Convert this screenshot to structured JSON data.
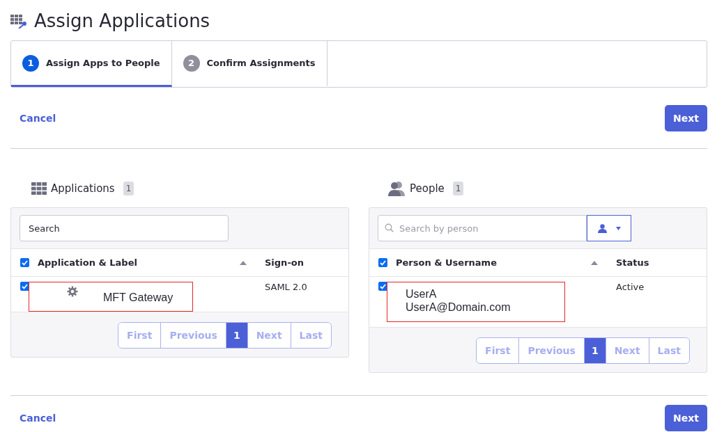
{
  "title": "Assign Applications",
  "steps": [
    {
      "number": "1",
      "label": "Assign Apps to People",
      "selected": true
    },
    {
      "number": "2",
      "label": "Confirm Assignments",
      "selected": false
    }
  ],
  "top_actions": {
    "cancel": "Cancel",
    "next": "Next"
  },
  "panels": [
    {
      "kind": "apps",
      "title": "Applications",
      "count": "1",
      "search": {
        "placeholder": "Search"
      },
      "columns": [
        "Application & Label",
        "Sign-on"
      ],
      "all_checked": true,
      "rows": [
        {
          "checked": true,
          "highlighted": true,
          "lines": [
            "MFT Gateway"
          ],
          "cell_2": "SAML 2.0"
        }
      ],
      "pagination": [
        {
          "label": "First",
          "selected": false,
          "disabled": true
        },
        {
          "label": "Previous",
          "selected": false,
          "disabled": true
        },
        {
          "label": "1",
          "selected": true,
          "disabled": false
        },
        {
          "label": "Next",
          "selected": false,
          "disabled": true
        },
        {
          "label": "Last",
          "selected": false,
          "disabled": true
        }
      ]
    },
    {
      "kind": "people",
      "title": "People",
      "count": "1",
      "search": {
        "placeholder": "Search by person"
      },
      "columns": [
        "Person & Username",
        "Status"
      ],
      "all_checked": true,
      "rows": [
        {
          "checked": true,
          "highlighted": true,
          "lines": [
            "UserA",
            "UserA@Domain.com"
          ],
          "cell_2": "Active"
        }
      ],
      "pagination": [
        {
          "label": "First",
          "selected": false,
          "disabled": true
        },
        {
          "label": "Previous",
          "selected": false,
          "disabled": true
        },
        {
          "label": "1",
          "selected": true,
          "disabled": false
        },
        {
          "label": "Next",
          "selected": false,
          "disabled": true
        },
        {
          "label": "Last",
          "selected": false,
          "disabled": true
        }
      ]
    }
  ],
  "bottom_actions": {
    "cancel": "Cancel",
    "next": "Next"
  }
}
